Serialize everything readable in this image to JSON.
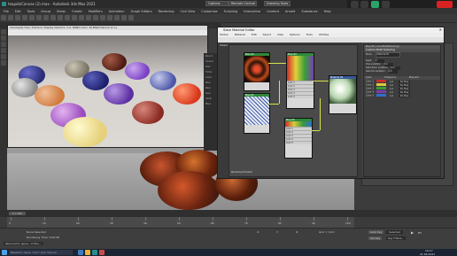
{
  "app": {
    "title": "teapotsCanvas (2).max - Autodesk 3ds Max 2021",
    "workspace_options": "Options",
    "workspace_remote": "Remote Control",
    "workspace_drawing": "Drawing Tools"
  },
  "menubar": [
    "File",
    "Edit",
    "Tools",
    "Group",
    "Views",
    "Create",
    "Modifiers",
    "Animation",
    "Graph Editors",
    "Rendering",
    "Civil View",
    "Customize",
    "Scripting",
    "Interactive",
    "Content",
    "Arnold",
    "Substance",
    "Help"
  ],
  "render_window": {
    "title": "Canvas(4).max, frame 0, Display Gamma: 2.2, RGBA Color 16 Bits/Channel (1:1)",
    "side_panel": [
      "Rend",
      "Scene",
      "Out",
      "Time",
      "Cam",
      "Ren",
      "Ren",
      "Asp",
      "Verb",
      "Bloc"
    ]
  },
  "material_editor": {
    "title": "Slate Material Editor",
    "menu": [
      "Modes",
      "Material",
      "Edit",
      "Select",
      "View",
      "Options",
      "Tools",
      "Utilities"
    ],
    "view_label": "View1",
    "nodes": [
      {
        "name": "Map #2",
        "type": "Color Map"
      },
      {
        "name": "Map #1",
        "type": "ColorMap"
      },
      {
        "name": "Map #4",
        "type": "ColorCorrection"
      },
      {
        "name": "Map #5",
        "type": "Color Multi"
      },
      {
        "name": "Material #1",
        "type": "Physical Material"
      }
    ],
    "slot_labels": [
      "Color 1",
      "Color 2",
      "Color 3",
      "Color 4",
      "Color 5"
    ],
    "status": "Rendering finished"
  },
  "params": {
    "header": "Map #5 ( ColorMultiTexturing )",
    "rollout": "Custom Multi Texturing",
    "mode_label": "Mode:",
    "mode_value": "Material ID",
    "seed_label": "Seed:",
    "seed_value": "0",
    "hue_label": "Hue variation",
    "hue_value": "0,0",
    "sat_label": "Saturation variation",
    "sat_value": "0,0",
    "gamma_label": "Gamma variation",
    "gamma_value": "0,0",
    "colors_header": [
      "Color",
      "Frequency",
      "Map slot"
    ],
    "colors": [
      {
        "label": "Color 1",
        "hex": "#cc2b2b",
        "freq": "1,0",
        "map": "No Map"
      },
      {
        "label": "Color 2",
        "hex": "#d8cc3a",
        "freq": "1,0",
        "map": "No Map"
      },
      {
        "label": "Color 3",
        "hex": "#3b9a3b",
        "freq": "1,0",
        "map": "No Map"
      },
      {
        "label": "Color 4",
        "hex": "#7a3fae",
        "freq": "1,0",
        "map": "No Map"
      },
      {
        "label": "Color 5",
        "hex": "#2e6fcf",
        "freq": "1,0",
        "map": "No Map"
      }
    ]
  },
  "timeline": {
    "frame": "0 / 100",
    "ticks": [
      "0",
      "10",
      "20",
      "30",
      "40",
      "50",
      "60",
      "70",
      "80",
      "90",
      "100"
    ]
  },
  "status": {
    "selection": "None Selected",
    "rendering_time": "Rendering Time: 0:00:06",
    "script_text": "Щелкните здесь, чтобы...",
    "x_label": "X:",
    "y_label": "Y:",
    "z_label": "Z:",
    "grid": "Grid = 10,0",
    "auto_key": "Auto Key",
    "selected": "Selected",
    "set_key": "Set Key",
    "key_filters": "Key Filters..."
  },
  "taskbar": {
    "search_placeholder": "Введите здесь текст для поиска",
    "time": "19:17",
    "date": "21.06.2021"
  },
  "colors": {
    "accent_yellow": "#d8e44a",
    "rec_red": "#d92323"
  }
}
